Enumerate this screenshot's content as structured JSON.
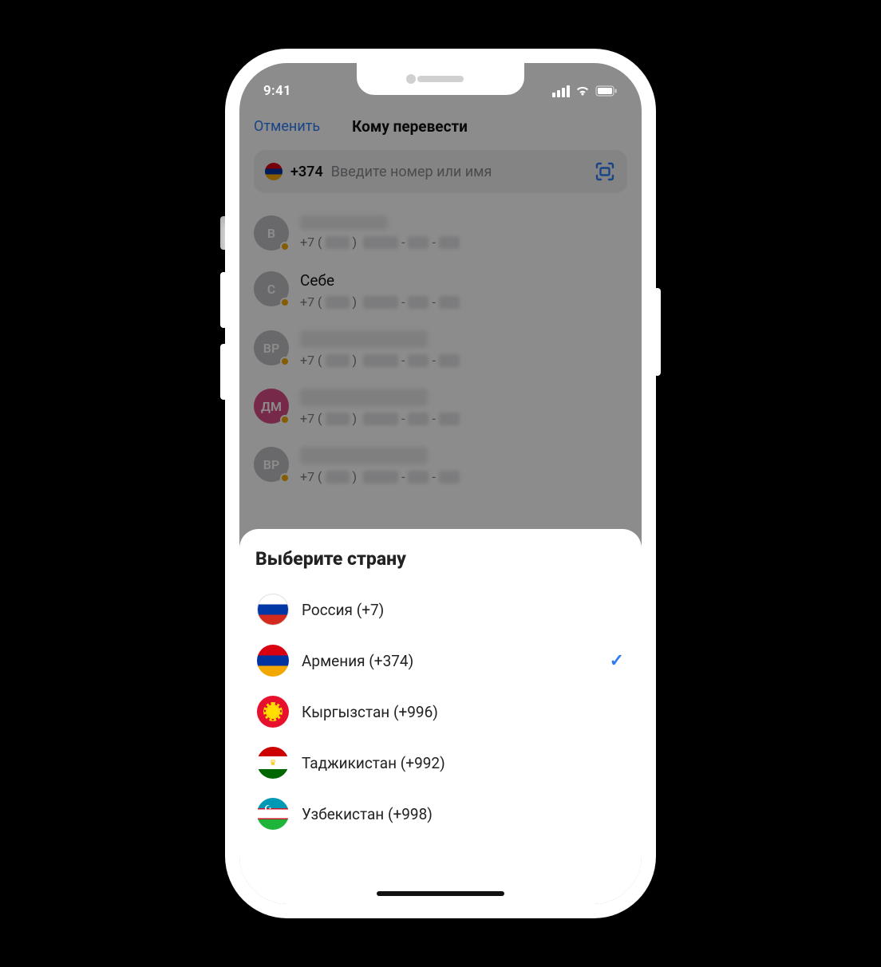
{
  "status": {
    "time": "9:41"
  },
  "nav": {
    "cancel": "Отменить",
    "title": "Кому перевести"
  },
  "search": {
    "code": "+374",
    "placeholder": "Введите номер или имя"
  },
  "contacts": [
    {
      "initials": "В",
      "phone_prefix": "+7 (",
      "color": "gray"
    },
    {
      "initials": "С",
      "name": "Себе",
      "phone_prefix": "+7 (",
      "color": "gray"
    },
    {
      "initials": "ВР",
      "phone_prefix": "+7 (",
      "color": "gray"
    },
    {
      "initials": "ДМ",
      "phone_prefix": "+7 (",
      "color": "pink"
    },
    {
      "initials": "ВР",
      "phone_prefix": "+7 (",
      "color": "gray"
    }
  ],
  "sheet": {
    "title": "Выберите страну",
    "countries": [
      {
        "flag": "ru",
        "label": "Россия (+7)",
        "selected": false
      },
      {
        "flag": "am",
        "label": "Армения (+374)",
        "selected": true
      },
      {
        "flag": "kg",
        "label": "Кыргызстан (+996)",
        "selected": false
      },
      {
        "flag": "tj",
        "label": "Таджикистан (+992)",
        "selected": false
      },
      {
        "flag": "uz",
        "label": "Узбекистан (+998)",
        "selected": false
      }
    ]
  }
}
